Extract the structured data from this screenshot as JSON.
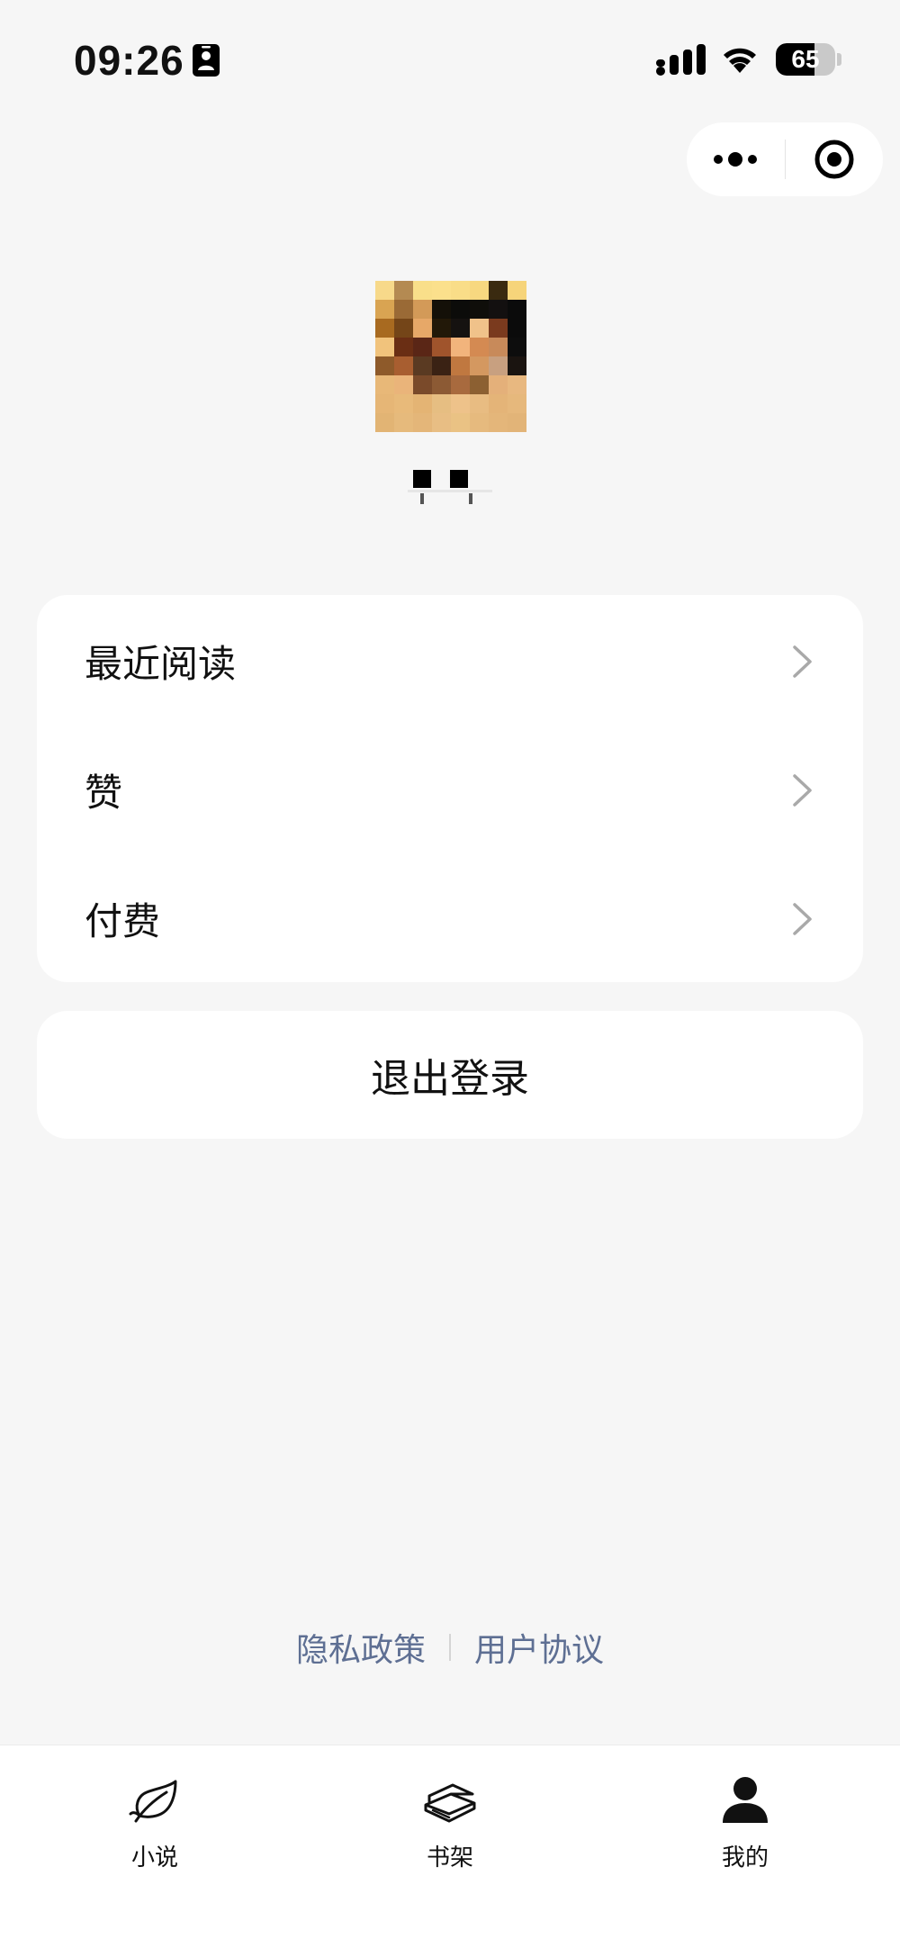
{
  "status_bar": {
    "time": "09:26",
    "battery_level": "65",
    "battery_fraction": 0.65,
    "icons": [
      "contact-card-icon",
      "cellular-signal-icon",
      "wifi-icon",
      "battery-icon"
    ]
  },
  "capsule": {
    "icons": [
      "more-dots-icon",
      "close-target-icon"
    ]
  },
  "profile": {
    "avatar_description_icon": "avatar-mosaic",
    "username": ""
  },
  "menu": {
    "items": [
      {
        "label": "最近阅读",
        "icon": "chevron-right-icon"
      },
      {
        "label": "赞",
        "icon": "chevron-right-icon"
      },
      {
        "label": "付费",
        "icon": "chevron-right-icon"
      }
    ]
  },
  "logout": {
    "label": "退出登录"
  },
  "footer": {
    "privacy_label": "隐私政策",
    "agreement_label": "用户协议"
  },
  "tabbar": {
    "tabs": [
      {
        "label": "小说",
        "icon": "leaf-book-icon",
        "active": false
      },
      {
        "label": "书架",
        "icon": "book-stack-icon",
        "active": false
      },
      {
        "label": "我的",
        "icon": "user-icon",
        "active": true
      }
    ]
  },
  "colors": {
    "background": "#f6f6f6",
    "card": "#ffffff",
    "link": "#5e6f93",
    "text": "#111111"
  }
}
